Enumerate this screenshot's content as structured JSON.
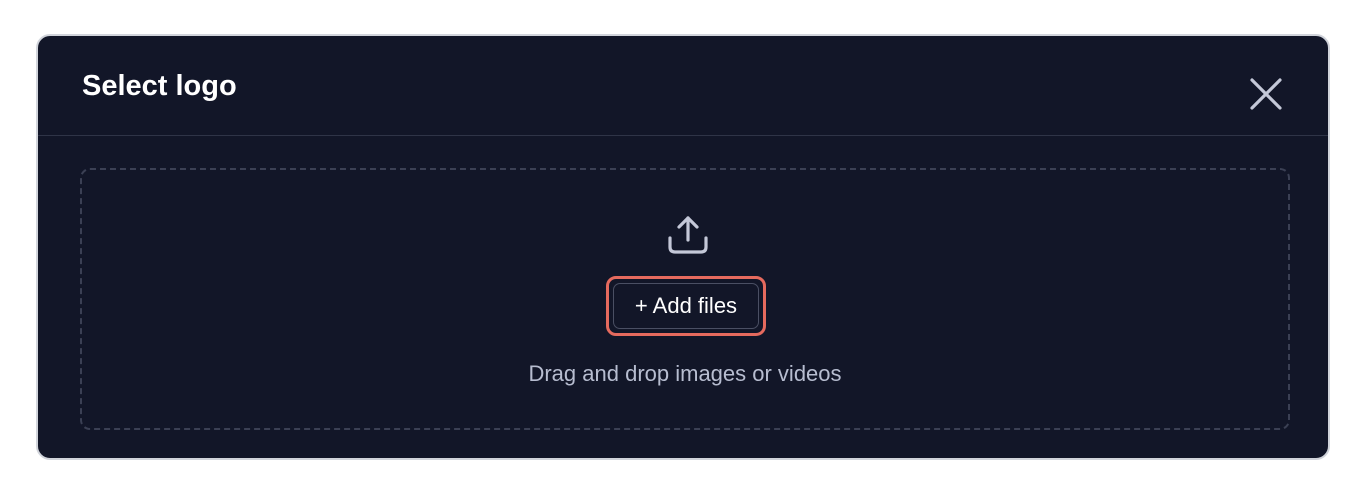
{
  "dialog": {
    "title": "Select logo",
    "close_icon": "close-icon",
    "dropzone": {
      "upload_icon": "upload-icon",
      "add_files_label": "+ Add files",
      "hint": "Drag and drop images or videos"
    }
  },
  "colors": {
    "dialog_background": "#121628",
    "dialog_border": "#d1d4db",
    "title_text": "#ffffff",
    "hint_text": "#b7bdd0",
    "dropzone_border": "#3b4054",
    "focus_ring": "#e56a5e",
    "icon": "#c4c8d8"
  }
}
